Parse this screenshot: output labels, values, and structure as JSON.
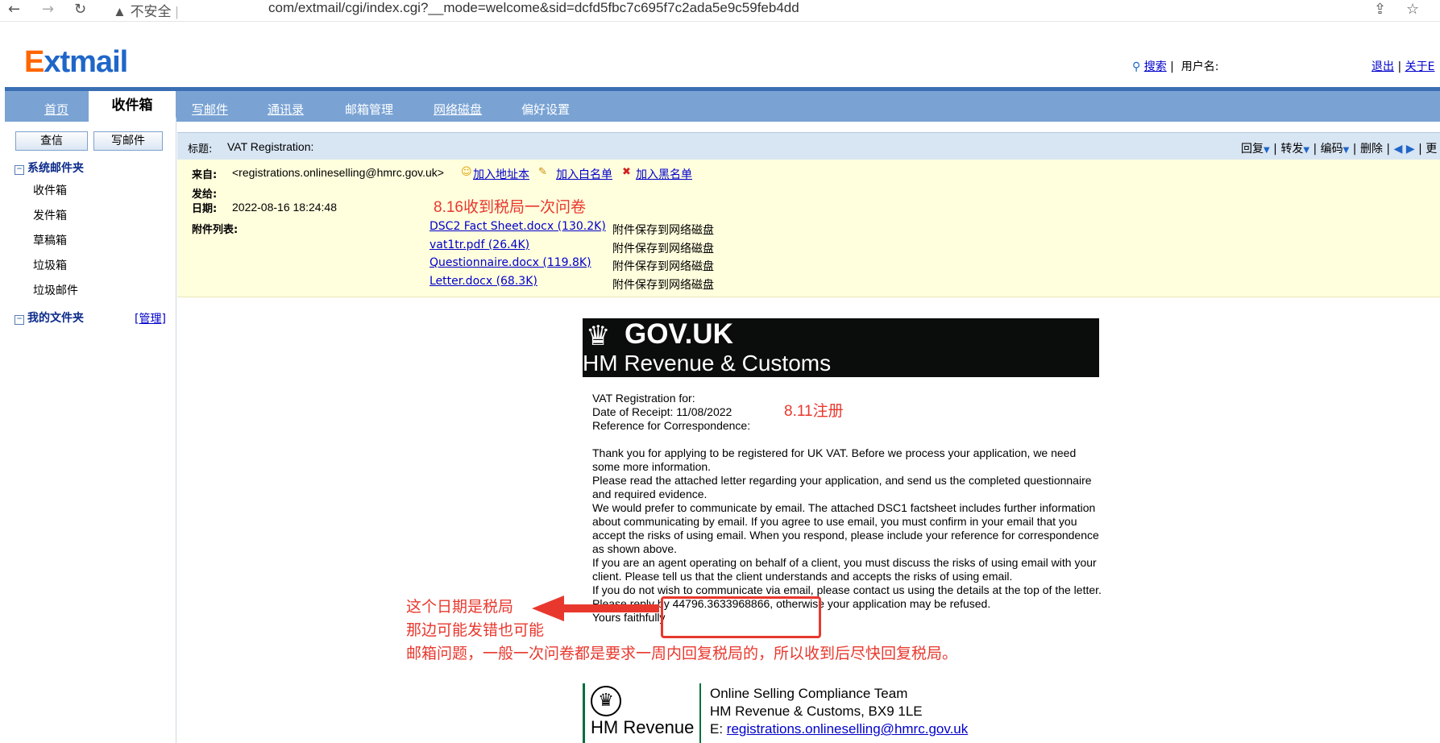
{
  "browser": {
    "insecure_label": "不安全",
    "url": "com/extmail/cgi/index.cgi?__mode=welcome&sid=dcfd5fbc7c695f7c2ada5e9c59feb4dd"
  },
  "header": {
    "logo_e": "E",
    "logo_rest": "xtmail",
    "search_link": "搜索",
    "username_label": "用户名:",
    "logout_link": "退出",
    "about_link": "关于E"
  },
  "nav": {
    "home": "首页",
    "inbox": "收件箱",
    "compose": "写邮件",
    "contacts": "通讯录",
    "mailbox_manage": "邮箱管理",
    "netdisk": "网络磁盘",
    "preferences": "偏好设置"
  },
  "sidebar": {
    "check_btn": "查信",
    "compose_btn": "写邮件",
    "system_folders": "系统邮件夹",
    "folders": [
      "收件箱",
      "发件箱",
      "草稿箱",
      "垃圾箱",
      "垃圾邮件"
    ],
    "my_folders": "我的文件夹",
    "manage_link": "[管理]"
  },
  "mail": {
    "subject_label": "标题:",
    "subject": "VAT Registration:",
    "toolbar": {
      "reply": "回复",
      "forward": "转发",
      "encoding": "编码",
      "delete": "删除",
      "more": "更"
    },
    "from_label": "来自:",
    "from": "<registrations.onlineselling@hmrc.gov.uk>",
    "add_contact": "加入地址本",
    "add_whitelist": "加入白名单",
    "add_blacklist": "加入黑名单",
    "to_label": "发给:",
    "date_label": "日期:",
    "date": "2022-08-16 18:24:48",
    "attach_label": "附件列表:",
    "attachments": [
      "DSC2 Fact Sheet.docx (130.2K)",
      "vat1tr.pdf (26.4K)",
      "Questionnaire.docx (119.8K)",
      "Letter.docx (68.3K)"
    ],
    "save_to_disk": "附件保存到网络磁盘"
  },
  "body": {
    "gov_title": "GOV.UK",
    "gov_subtitle": "HM Revenue & Customs",
    "vat_for": "VAT Registration for:",
    "date_receipt": "Date of Receipt: 11/08/2022",
    "reference": "Reference for Correspondence:",
    "p1": "Thank you for applying to be registered for UK VAT. Before we process your application, we need some more information.",
    "p2": "Please read the attached letter regarding your application, and send us the completed questionnaire and required evidence.",
    "p3": "We would prefer to communicate by email. The attached DSC1 factsheet includes further information about communicating by email. If you agree to use email, you must confirm in your email that you accept the risks of using email. When you respond, please include your reference for correspondence as shown above.",
    "p4": "If you are an agent operating on behalf of a client, you must discuss the risks of using email with your client. Please tell us that the client understands and accepts the risks of using email.",
    "p5": "If you do not wish to communicate via email, please contact us using the details at the top of the letter.",
    "p6": "Please reply by 44796.3633968866, otherwise your application may be refused.",
    "p7": "Yours faithfully",
    "footer_org": "HM Revenue",
    "team": "Online Selling Compliance Team",
    "address": "HM Revenue & Customs, BX9 1LE",
    "email_prefix": "E: ",
    "email": "registrations.onlineselling@hmrc.gov.uk"
  },
  "annotations": {
    "received": "8.16收到税局一次问卷",
    "registered": "8.11注册",
    "date_note_1": "这个日期是税局",
    "date_note_2": "那边可能发错也可能",
    "date_note_3": "邮箱问题，一般一次问卷都是要求一周内回复税局的，所以收到后尽快回复税局。"
  },
  "colors": {
    "nav_bg": "#7aa3d4",
    "subject_bg": "#d8e5f3",
    "info_bg": "#fffedd",
    "annotation_red": "#e8382e",
    "gov_banner": "#0b0c0c"
  }
}
